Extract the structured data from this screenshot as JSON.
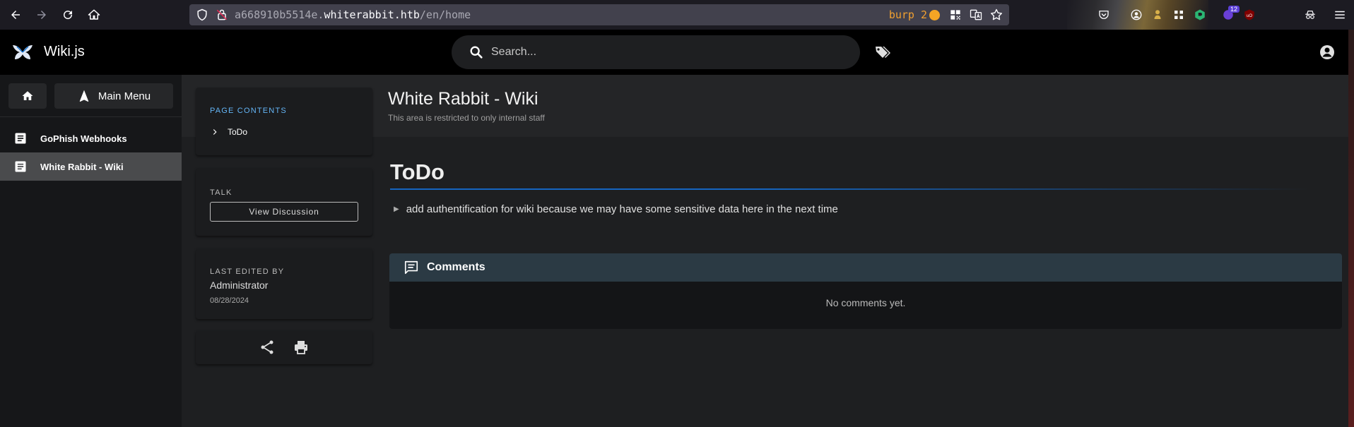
{
  "browser": {
    "url_prefix": "a668910b5514e.",
    "url_host": "whiterabbit.htb",
    "url_path": "/en/home",
    "burp_label": "burp 2",
    "ext_badge": "12"
  },
  "app": {
    "title": "Wiki.js",
    "search_placeholder": "Search..."
  },
  "sidebar": {
    "main_menu_label": "Main Menu",
    "items": [
      {
        "label": "GoPhish Webhooks",
        "active": false
      },
      {
        "label": "White Rabbit - Wiki",
        "active": true
      }
    ]
  },
  "page": {
    "title": "White Rabbit - Wiki",
    "description": "This area is restricted to only internal staff",
    "toc": {
      "label": "PAGE CONTENTS",
      "items": [
        "ToDo"
      ]
    },
    "talk": {
      "label": "TALK",
      "button_label": "View Discussion"
    },
    "last_edited": {
      "label": "LAST EDITED BY",
      "name": "Administrator",
      "date": "08/28/2024"
    },
    "content": {
      "heading": "ToDo",
      "details_summary": "add authentification for wiki because we may have some sensitive data here in the next time"
    },
    "comments": {
      "title": "Comments",
      "empty_text": "No comments yet."
    }
  },
  "colors": {
    "accent": "#1565c0",
    "toc_label": "#64b5f6",
    "comments_header": "#2b3a44",
    "active_item": "#4a4b4d"
  }
}
